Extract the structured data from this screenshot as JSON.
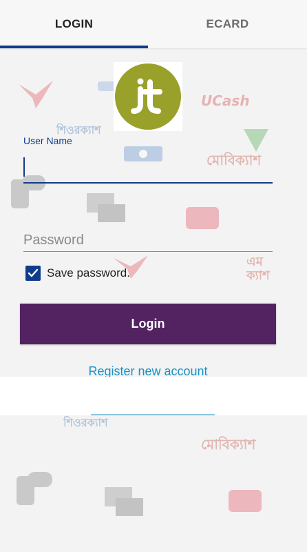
{
  "tabs": [
    {
      "label": "LOGIN"
    },
    {
      "label": "ECARD"
    }
  ],
  "background": {
    "words": [
      {
        "text": "UCash",
        "color": "#d33b3b"
      },
      {
        "text": "শিওরক্যাশ",
        "color": "#3b6fb0"
      },
      {
        "text": "মোবিক্যাশ",
        "color": "#c44b3a"
      },
      {
        "text": "এম ক্যাশ",
        "color": "#c44b3a"
      },
      {
        "text": "শিওরক্যাশ",
        "color": "#3b6fb0"
      },
      {
        "text": "মোবিক্যাশ",
        "color": "#c44b3a"
      }
    ]
  },
  "logo": {
    "text": "jt",
    "color": "#9aa12a"
  },
  "form": {
    "username_label": "User Name",
    "username_value": "",
    "password_placeholder": "Password",
    "save_password_label": "Save password.",
    "save_password_checked": true,
    "login_label": "Login",
    "register_label": "Register new account"
  },
  "colors": {
    "accent": "#0f3c8a",
    "button": "#532261",
    "link": "#1a90c4"
  }
}
